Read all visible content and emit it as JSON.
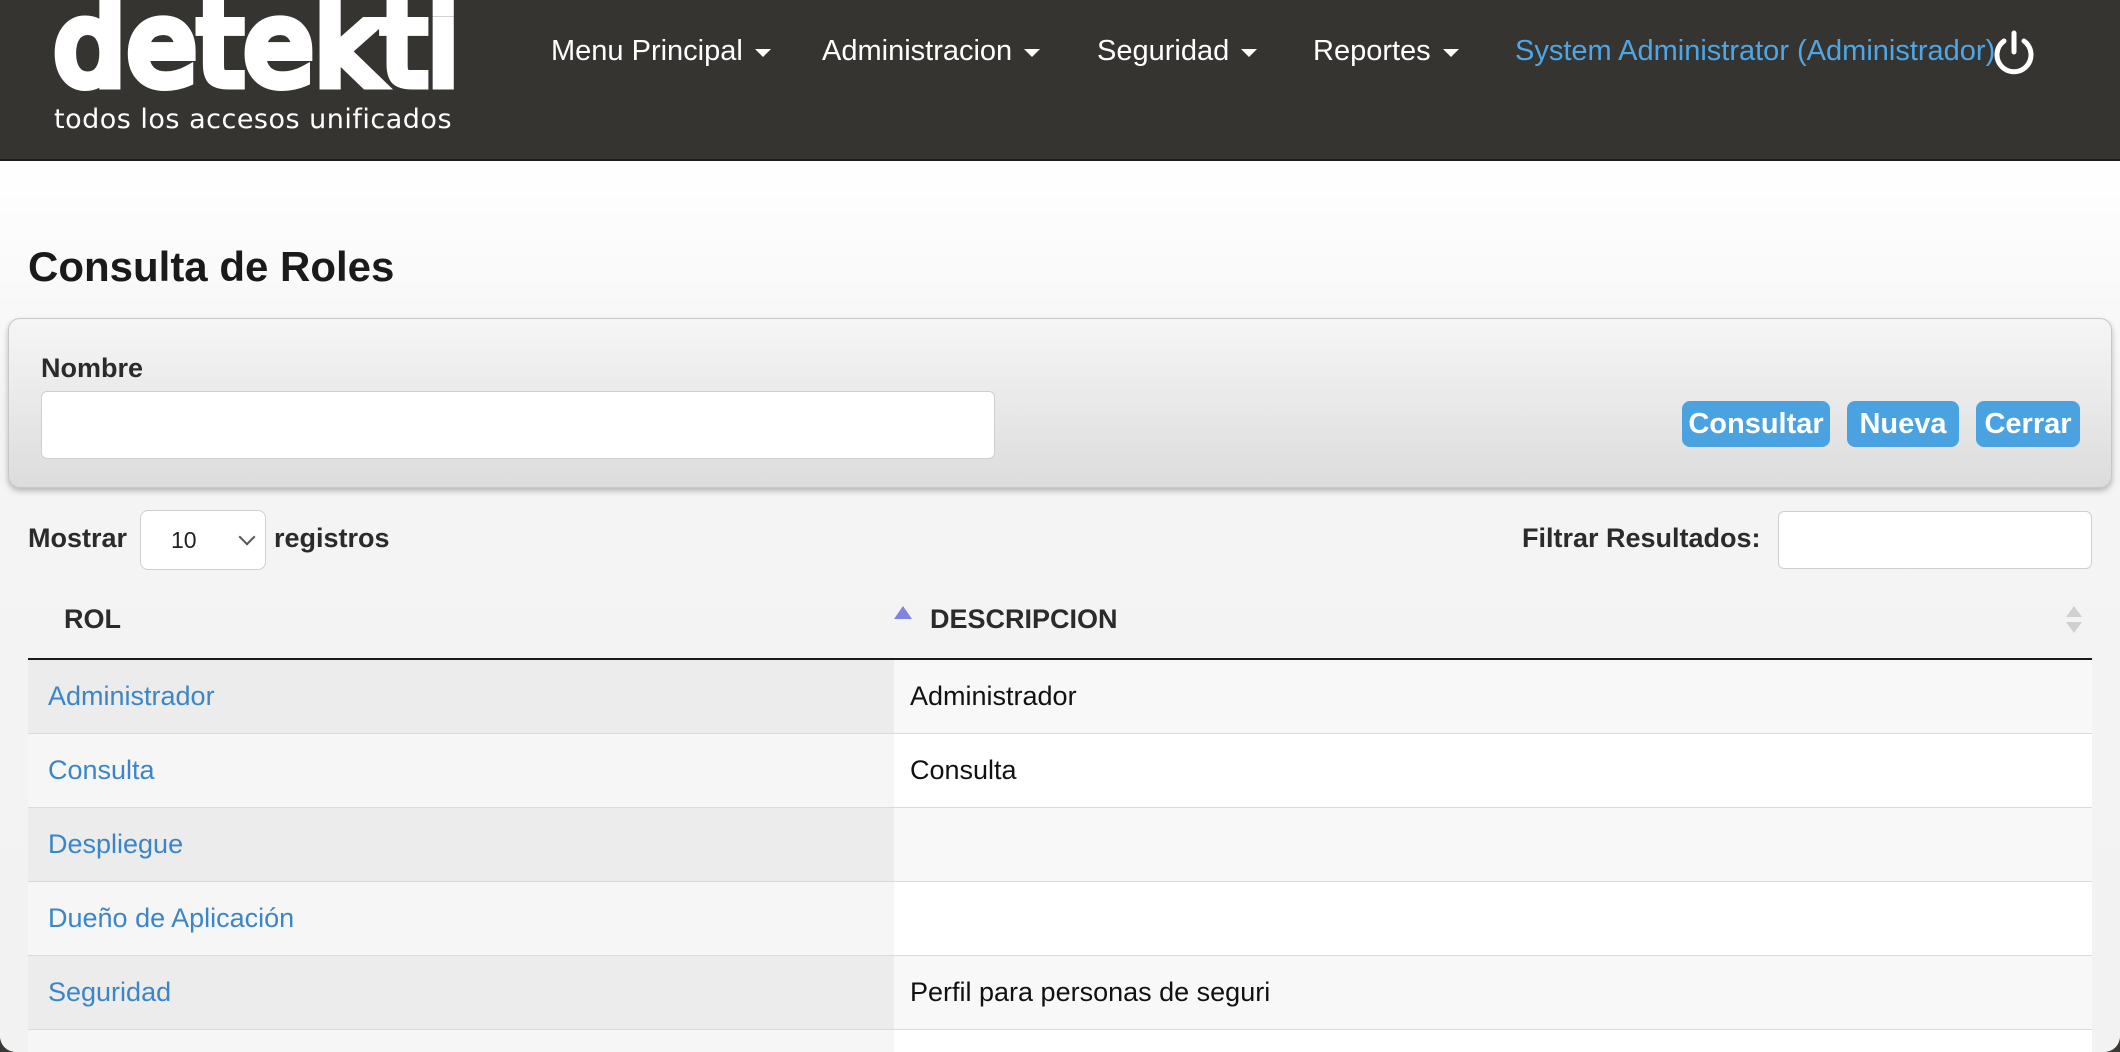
{
  "brand": {
    "logo_text": "detekti",
    "tagline": "todos los accesos unificados"
  },
  "nav": {
    "items": [
      {
        "label": "Menu Principal"
      },
      {
        "label": "Administracion"
      },
      {
        "label": "Seguridad"
      },
      {
        "label": "Reportes"
      }
    ],
    "user": "System Administrator (Administrador)",
    "logout_icon": "power-icon"
  },
  "page": {
    "title": "Consulta de Roles"
  },
  "filter": {
    "name_label": "Nombre",
    "name_value": "",
    "buttons": {
      "consultar": "Consultar",
      "nueva": "Nueva",
      "cerrar": "Cerrar"
    }
  },
  "list_controls": {
    "show_prefix": "Mostrar",
    "page_size": "10",
    "show_suffix": "registros",
    "filter_label": "Filtrar Resultados:",
    "filter_value": ""
  },
  "table": {
    "columns": [
      "ROL",
      "DESCRIPCION"
    ],
    "sort_column": "ROL",
    "sort_direction": "asc",
    "rows": [
      {
        "rol": "Administrador",
        "descripcion": "Administrador"
      },
      {
        "rol": "Consulta",
        "descripcion": "Consulta"
      },
      {
        "rol": "Despliegue",
        "descripcion": ""
      },
      {
        "rol": "Dueño de Aplicación",
        "descripcion": ""
      },
      {
        "rol": "Seguridad",
        "descripcion": "Perfil para personas de seguri"
      }
    ]
  },
  "colors": {
    "navbar_bg": "#353431",
    "accent": "#4aa3e0",
    "link": "#3a86c8",
    "user_link": "#4ea6e6"
  }
}
